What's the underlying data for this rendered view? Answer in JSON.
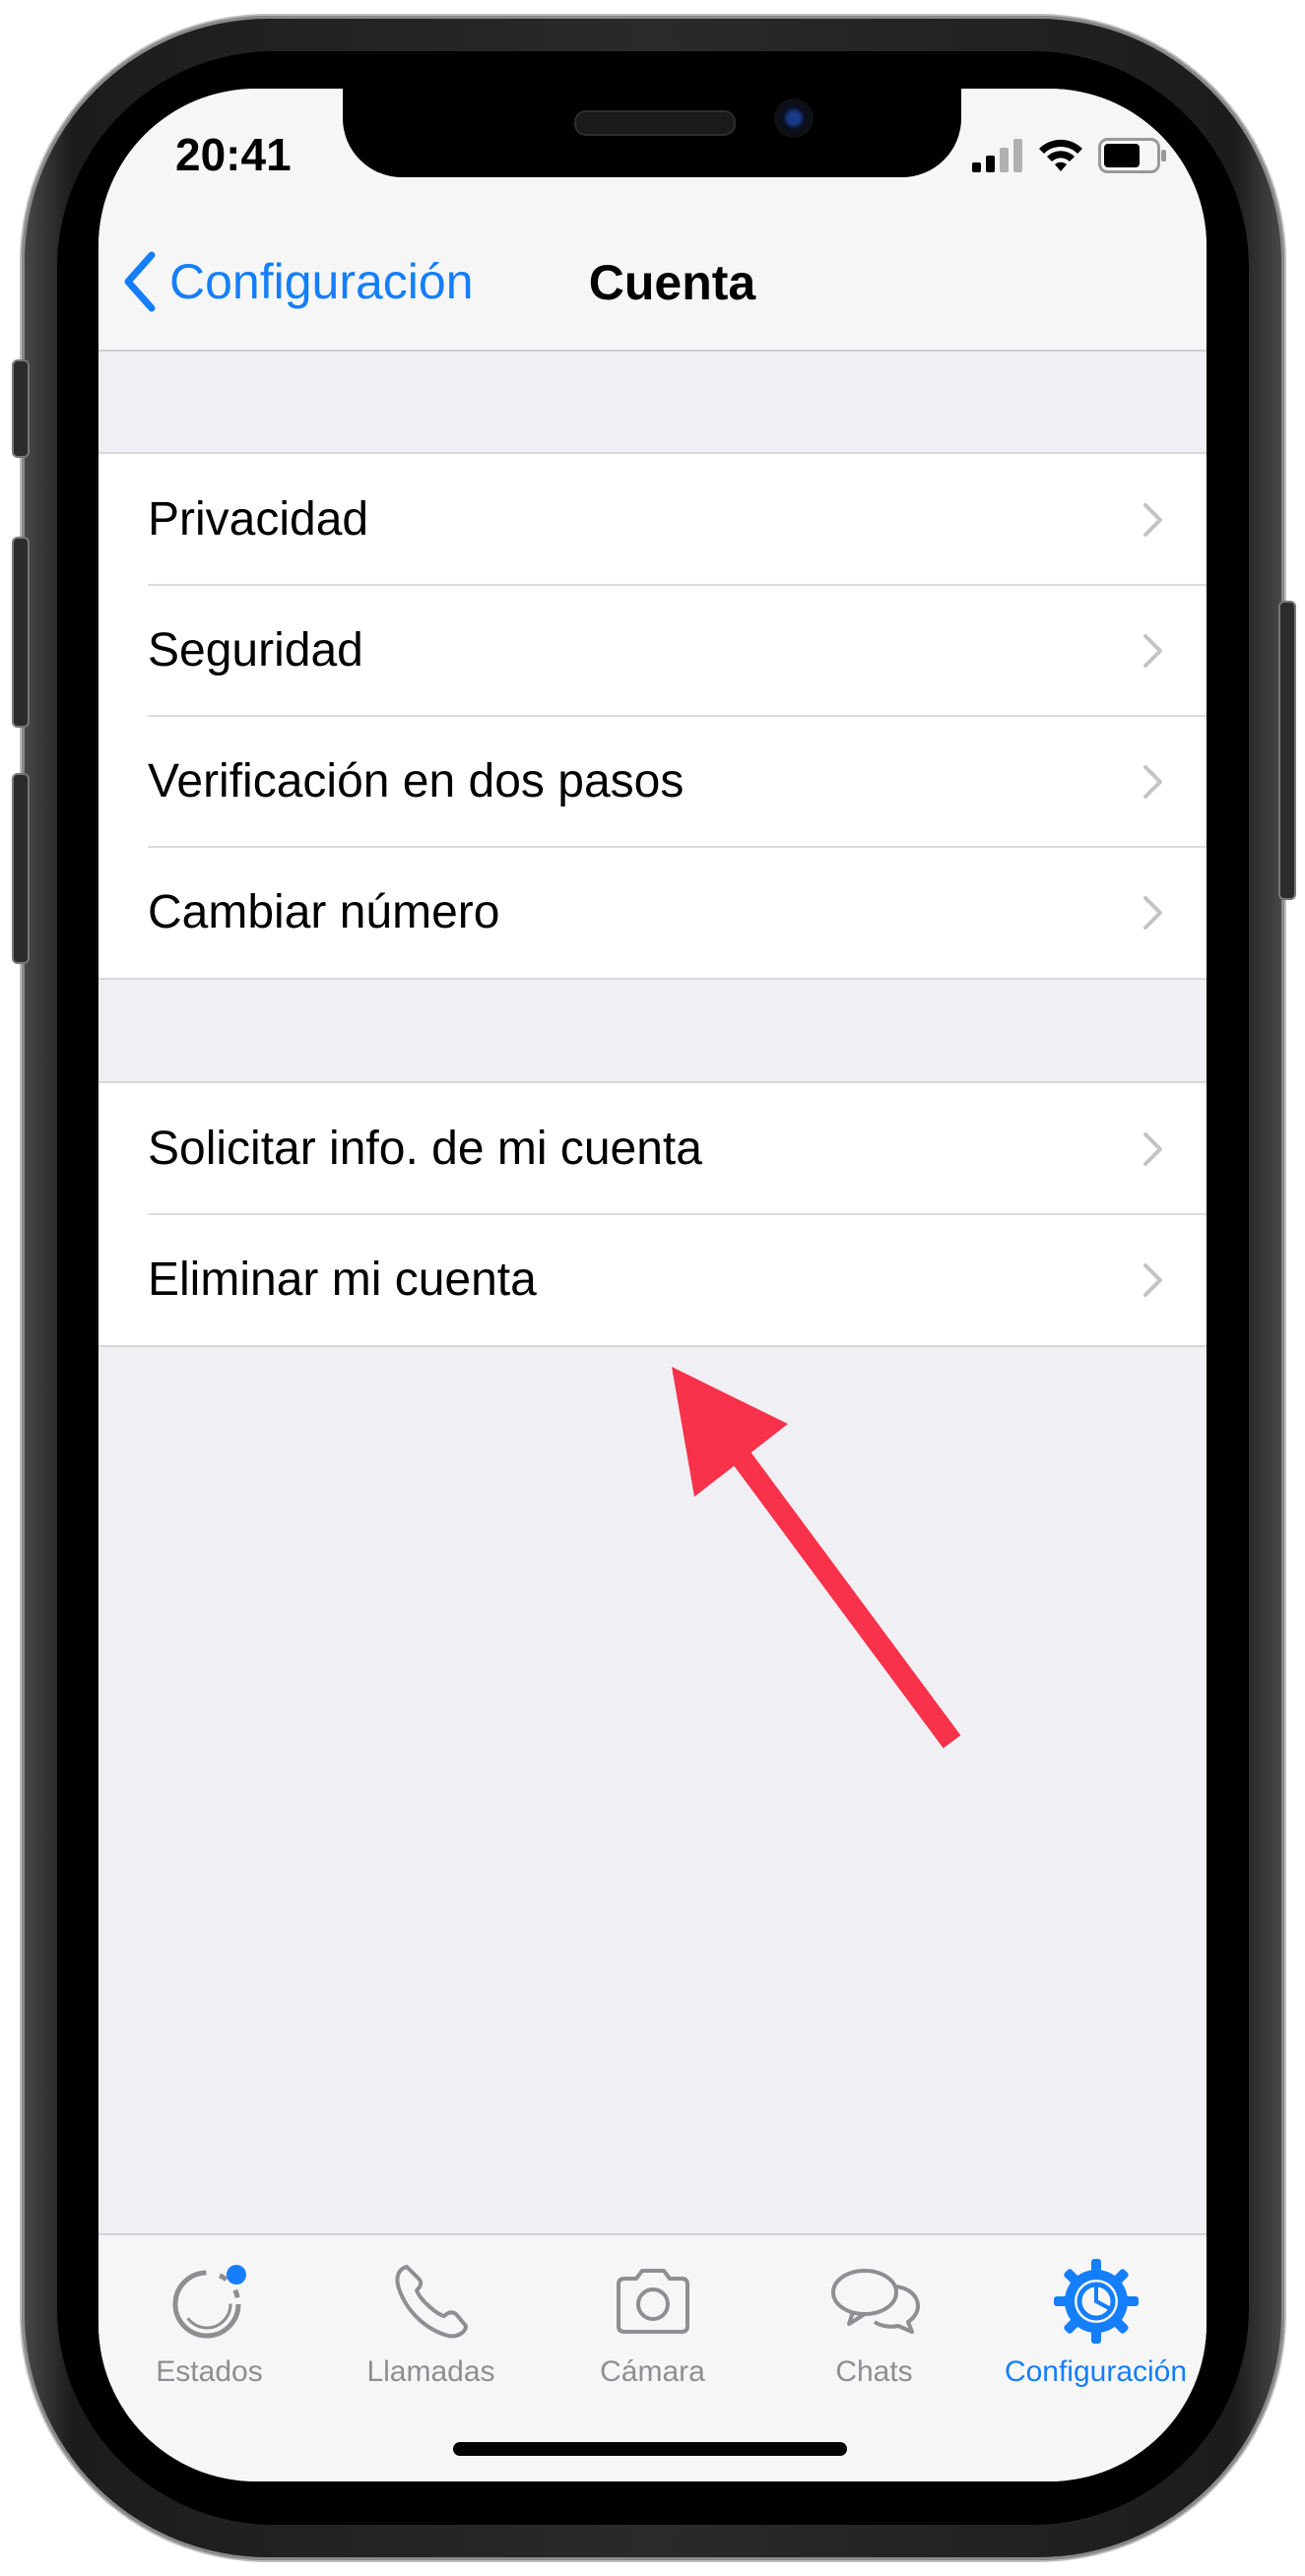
{
  "status_bar": {
    "time": "20:41"
  },
  "nav": {
    "back_label": "Configuración",
    "title": "Cuenta"
  },
  "groups": [
    {
      "items": [
        {
          "label": "Privacidad"
        },
        {
          "label": "Seguridad"
        },
        {
          "label": "Verificación en dos pasos"
        },
        {
          "label": "Cambiar número"
        }
      ]
    },
    {
      "items": [
        {
          "label": "Solicitar info. de mi cuenta"
        },
        {
          "label": "Eliminar mi cuenta"
        }
      ]
    }
  ],
  "tabbar": {
    "tabs": [
      {
        "label": "Estados",
        "icon": "status-ring-icon",
        "active": false
      },
      {
        "label": "Llamadas",
        "icon": "phone-icon",
        "active": false
      },
      {
        "label": "Cámara",
        "icon": "camera-icon",
        "active": false
      },
      {
        "label": "Chats",
        "icon": "chat-bubbles-icon",
        "active": false
      },
      {
        "label": "Configuración",
        "icon": "gear-icon",
        "active": true
      }
    ]
  },
  "colors": {
    "accent": "#157efb",
    "annotation_arrow": "#f7324a",
    "inactive_tab": "#8e8e93",
    "group_background": "#efeff4"
  }
}
